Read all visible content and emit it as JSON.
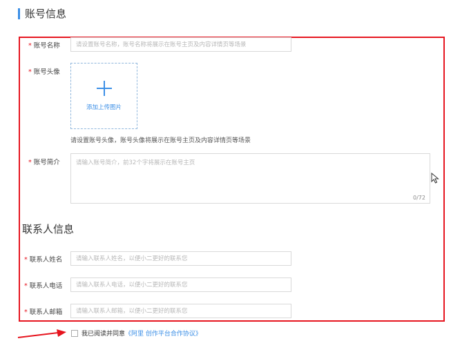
{
  "account_section": {
    "title": "账号信息",
    "name": {
      "required_mark": "*",
      "label": "账号名称",
      "placeholder": "请设置账号名称，账号名称将展示在账号主页及内容详情页等场景"
    },
    "avatar": {
      "required_mark": "*",
      "label": "账号头像",
      "upload_label": "添加上传图片",
      "hint": "请设置账号头像，账号头像将展示在账号主页及内容详情页等场景"
    },
    "intro": {
      "required_mark": "*",
      "label": "账号简介",
      "placeholder": "请输入账号简介，前32个字将展示在账号主页",
      "counter": "0/72"
    }
  },
  "contact_section": {
    "title": "联系人信息",
    "name": {
      "required_mark": "*",
      "label": "联系人姓名",
      "placeholder": "请输入联系人姓名，以便小二更好的联系您"
    },
    "phone": {
      "required_mark": "*",
      "label": "联系人电话",
      "placeholder": "请输入联系人电话，以便小二更好的联系您"
    },
    "email": {
      "required_mark": "*",
      "label": "联系人邮箱",
      "placeholder": "请输入联系人邮箱，以便小二更好的联系您"
    }
  },
  "agreement": {
    "text": "我已阅读并同意",
    "link": "《阿里 创作平台合作协议》",
    "checked": false
  },
  "colors": {
    "accent": "#3a8ee6",
    "highlight_border": "#e6141e",
    "required": "#e6141e"
  },
  "icons": {
    "upload": "plus-icon",
    "cursor": "mouse-pointer-icon",
    "annotation": "red-arrow-icon"
  }
}
